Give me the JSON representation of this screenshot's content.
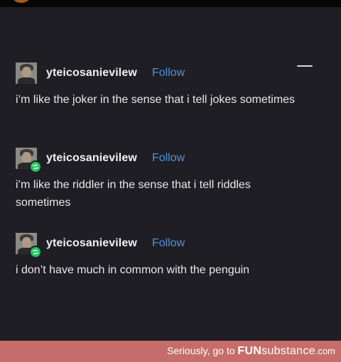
{
  "posts": [
    {
      "username": "yteicosanievilew",
      "follow_label": "Follow",
      "text": "i’m like the joker in the sense that i tell jokes sometimes",
      "reblogged": false
    },
    {
      "username": "yteicosanievilew",
      "follow_label": "Follow",
      "text": "i’m like the riddler in the sense that i tell riddles sometimes",
      "reblogged": true
    },
    {
      "username": "yteicosanievilew",
      "follow_label": "Follow",
      "text": "i don’t have much in common with the penguin",
      "reblogged": true
    }
  ],
  "watermark": {
    "prefix": "Seriously, go to ",
    "brand_fun": "FUN",
    "brand_substance": "substance",
    "brand_tld": ".com"
  },
  "colors": {
    "card_background": "#1f1e24",
    "follow_link": "#4e93d8",
    "reblog_badge": "#21c25e",
    "footer_bar": "#c56d6a"
  },
  "icons": {
    "menu": "menu-dash-icon",
    "reblog": "reblog-icon"
  }
}
